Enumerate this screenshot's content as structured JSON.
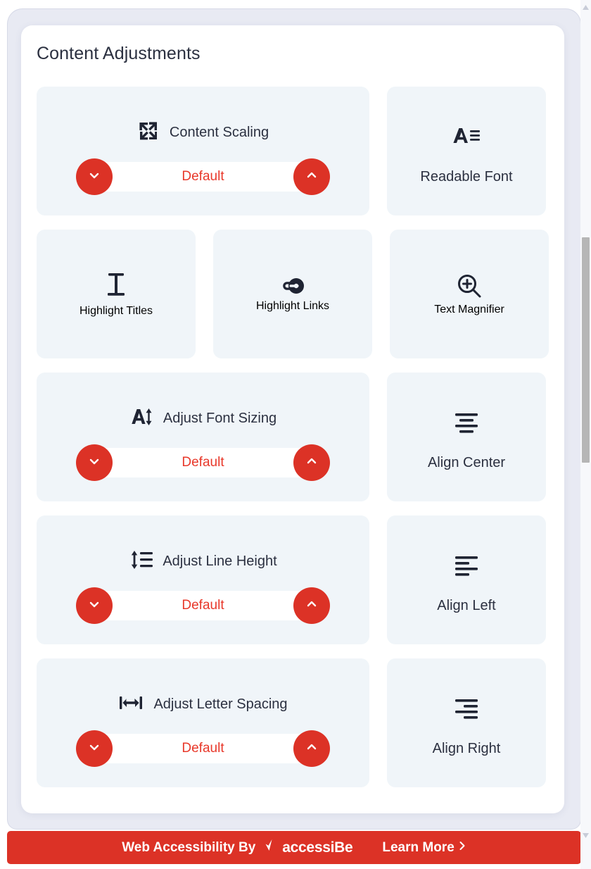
{
  "panel": {
    "title": "Content Adjustments"
  },
  "rows": [
    {
      "stepper": {
        "icon": "content-scaling-icon",
        "label": "Content Scaling",
        "value": "Default",
        "decrease_icon": "chevron-down-icon",
        "increase_icon": "chevron-up-icon"
      },
      "square": {
        "icon": "readable-font-icon",
        "label": "Readable Font"
      }
    },
    {
      "triple": [
        {
          "icon": "highlight-titles-icon",
          "label": "Highlight Titles"
        },
        {
          "icon": "highlight-links-icon",
          "label": "Highlight Links"
        },
        {
          "icon": "text-magnifier-icon",
          "label": "Text Magnifier"
        }
      ]
    },
    {
      "stepper": {
        "icon": "adjust-font-sizing-icon",
        "label": "Adjust Font Sizing",
        "value": "Default",
        "decrease_icon": "chevron-down-icon",
        "increase_icon": "chevron-up-icon"
      },
      "square": {
        "icon": "align-center-icon",
        "label": "Align Center"
      }
    },
    {
      "stepper": {
        "icon": "adjust-line-height-icon",
        "label": "Adjust Line Height",
        "value": "Default",
        "decrease_icon": "chevron-down-icon",
        "increase_icon": "chevron-up-icon"
      },
      "square": {
        "icon": "align-left-icon",
        "label": "Align Left"
      }
    },
    {
      "stepper": {
        "icon": "adjust-letter-spacing-icon",
        "label": "Adjust Letter Spacing",
        "value": "Default",
        "decrease_icon": "chevron-down-icon",
        "increase_icon": "chevron-up-icon"
      },
      "square": {
        "icon": "align-right-icon",
        "label": "Align Right"
      }
    }
  ],
  "footer": {
    "text": "Web Accessibility By",
    "brand_icon": "accessibe-check-icon",
    "brand_name": "accessiBe",
    "learn_more": "Learn More",
    "learn_more_chevron": "chevron-right-icon"
  },
  "colors": {
    "accent_red": "#dc3226",
    "value_red": "#e8382a",
    "card_bg": "#f0f5f9",
    "panel_bg": "#ffffff",
    "shell_bg": "#e8eaf3",
    "text_dark": "#2b3040"
  },
  "scrollbar": {
    "up_icon": "scroll-up-arrow-icon",
    "down_icon": "scroll-down-arrow-icon",
    "thumb": "scrollbar-thumb"
  }
}
